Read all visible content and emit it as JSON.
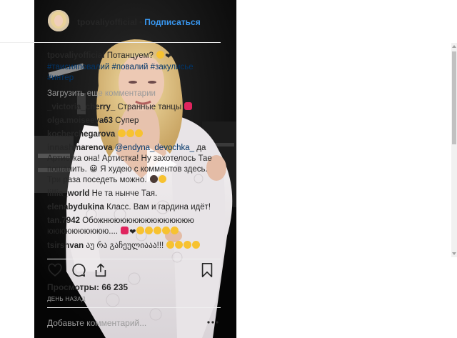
{
  "header": {
    "username": "tpovaliyofficial",
    "separator": "•",
    "follow_label": "Подписаться"
  },
  "caption": {
    "username": "tpovaliyofficial",
    "text": "Потанцуем?",
    "hashtags": [
      "#таисияповалий",
      "#повалий",
      "#закулисье",
      "#интер"
    ]
  },
  "load_more": "Загрузить еще комментарии",
  "comments": [
    {
      "user": "_victoria_cherry_",
      "text": "Странные танцы"
    },
    {
      "user": "olga.moiseeva63",
      "text": "Супер"
    },
    {
      "user": "kocherchegarova",
      "text": ""
    },
    {
      "user": "innashmarenova",
      "mention": "@endyna_devochka_",
      "text": "да Артистка она! Артистка! Ну захотелось Тае пошалить. 😀 Я худею с комментов здесь. Три раза поседеть можно."
    },
    {
      "user": "lillia_world",
      "text": "Не та нынче Тая."
    },
    {
      "user": "elenabydukina",
      "text": "Класс. Вам и гардина идёт!"
    },
    {
      "user": "tan.7942",
      "text": "Обожнюююююююююююююю юююююююююю...."
    },
    {
      "user": "tsirshvan",
      "text": "აუ რა გაჩეულიააა!!!"
    }
  ],
  "views": "Просмотры: 66 235",
  "time": "ДЕНЬ НАЗАД",
  "add_comment_placeholder": "Добавьте комментарий...",
  "icons": [
    "heart-icon",
    "comment-icon",
    "share-icon",
    "bookmark-icon",
    "more-icon",
    "play-icon"
  ],
  "colors": {
    "link": "#3897f0",
    "hashtag": "#003569",
    "muted": "#999999"
  }
}
